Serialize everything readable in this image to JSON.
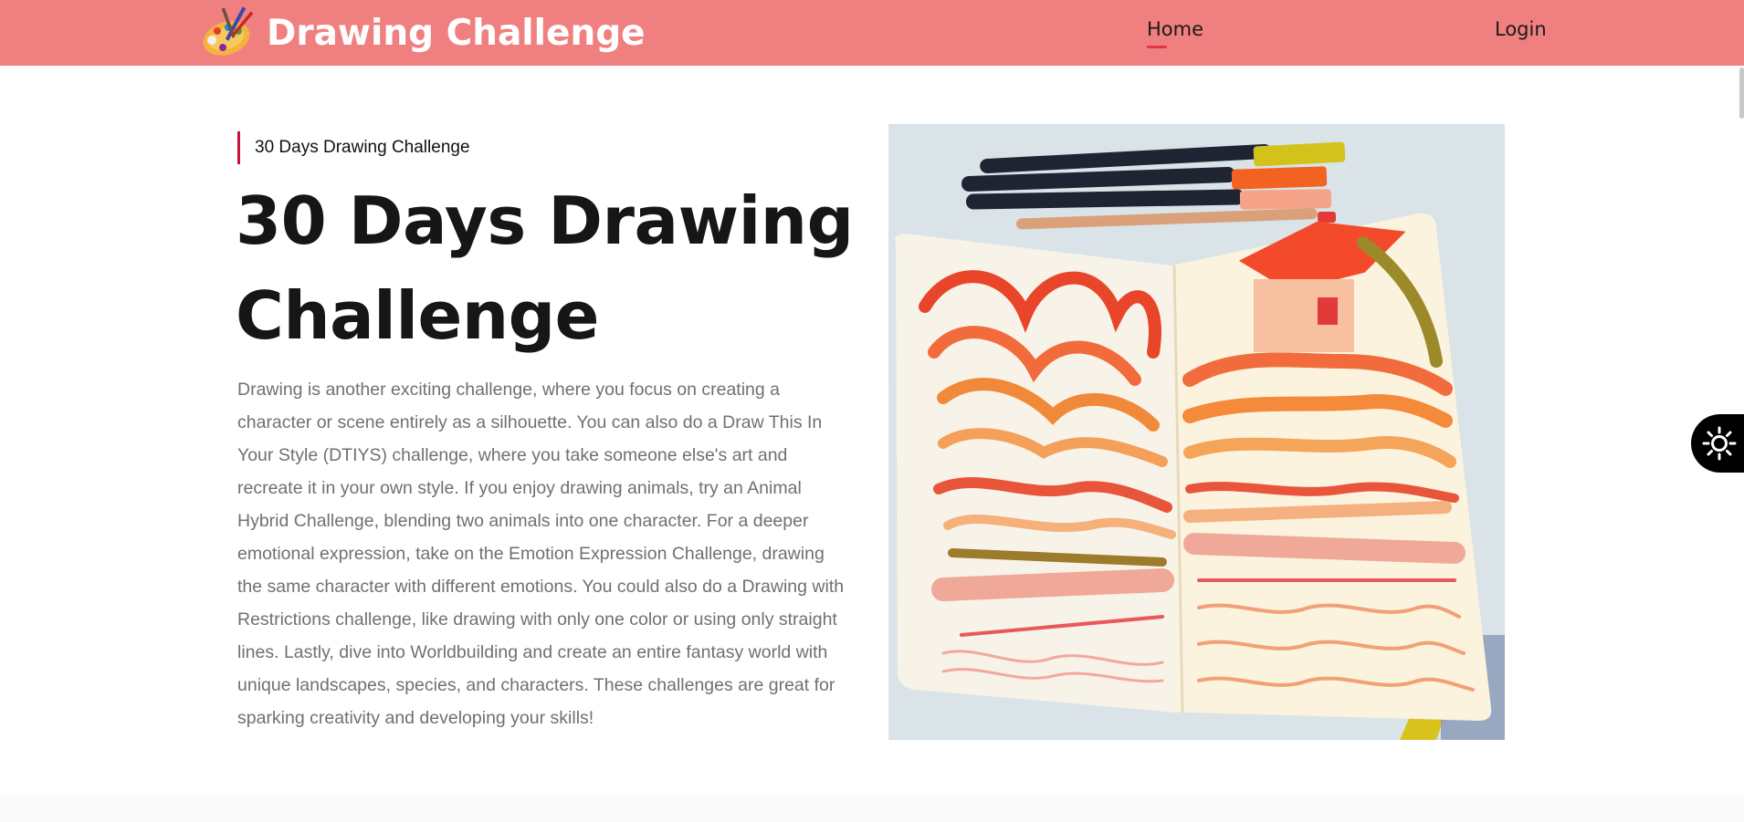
{
  "nav": {
    "brand_name": "Drawing Challenge",
    "brand_logo_icon": "paint-palette-icon",
    "links": [
      {
        "label": "Home",
        "active": true
      },
      {
        "label": "Login",
        "active": false
      }
    ]
  },
  "hero": {
    "eyebrow": "30 Days Drawing Challenge",
    "title": "30 Days Drawing Challenge",
    "body": "Drawing is another exciting challenge, where you focus on creating a character or scene entirely as a silhouette. You can also do a Draw This In Your Style (DTIYS) challenge, where you take someone else's art and recreate it in your own style. If you enjoy drawing animals, try an Animal Hybrid Challenge, blending two animals into one character. For a deeper emotional expression, take on the Emotion Expression Challenge, drawing the same character with different emotions. You could also do a Drawing with Restrictions challenge, like drawing with only one color or using only straight lines. Lastly, dive into Worldbuilding and create an entire fantasy world with unique landscapes, species, and characters. These challenges are great for sparking creativity and developing your skills!",
    "image_icon": "sketchbook-photo"
  },
  "theme_toggle": {
    "icon": "sun-icon"
  },
  "colors": {
    "navbar": "#f08080",
    "accent": "#c8103f",
    "active_underline": "#e3344b",
    "body_text": "#707070",
    "title_text": "#161616"
  }
}
